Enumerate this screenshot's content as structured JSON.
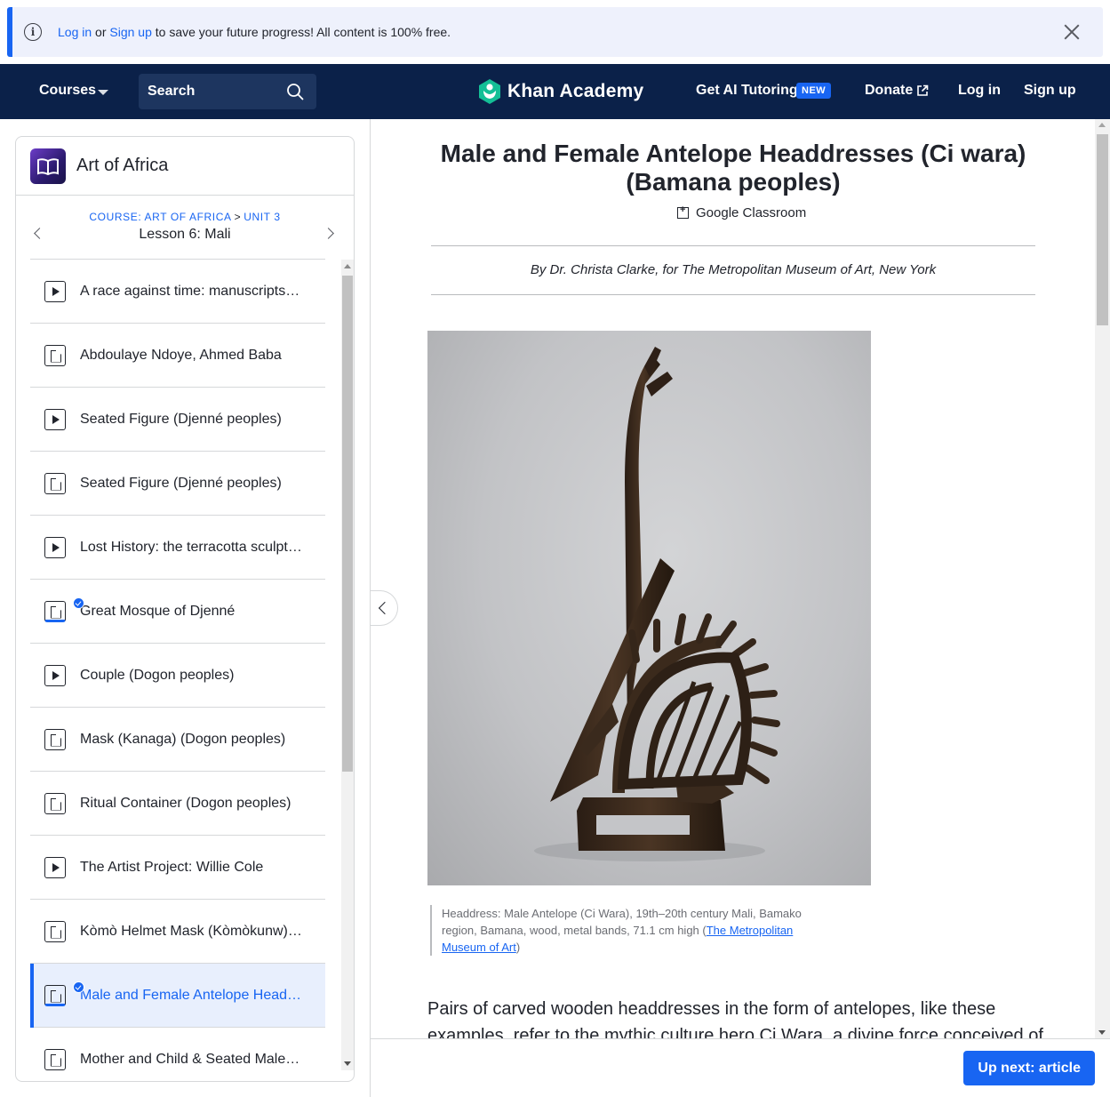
{
  "banner": {
    "login_link": "Log in",
    "or_text": " or ",
    "signup_link": "Sign up",
    "message": " to save your future progress! All content is 100% free."
  },
  "nav": {
    "courses": "Courses",
    "search_placeholder": "Search",
    "logo_text": "Khan Academy",
    "ai_tutoring": "Get AI Tutoring",
    "new_badge": "NEW",
    "donate": "Donate",
    "login": "Log in",
    "signup": "Sign up",
    "brand_color": "#0b2149",
    "accent_color": "#1865f2"
  },
  "sidebar": {
    "course_title": "Art of Africa",
    "breadcrumb_course": "COURSE: ART OF AFRICA",
    "breadcrumb_sep": ">",
    "breadcrumb_unit": "UNIT 3",
    "lesson_title": "Lesson 6: Mali",
    "items": [
      {
        "label": "A race against time: manuscripts of Timbuktu",
        "type": "video",
        "done": false,
        "active": false
      },
      {
        "label": "Abdoulaye Ndoye, Ahmed Baba",
        "type": "article",
        "done": false,
        "active": false
      },
      {
        "label": "Seated Figure (Djenné peoples)",
        "type": "video",
        "done": false,
        "active": false
      },
      {
        "label": "Seated Figure (Djenné peoples)",
        "type": "article",
        "done": false,
        "active": false
      },
      {
        "label": "Lost History: the terracotta sculpture of Djenné",
        "type": "video",
        "done": false,
        "active": false
      },
      {
        "label": "Great Mosque of Djenné",
        "type": "article",
        "done": true,
        "active": false
      },
      {
        "label": "Couple (Dogon peoples)",
        "type": "video",
        "done": false,
        "active": false
      },
      {
        "label": "Mask (Kanaga) (Dogon peoples)",
        "type": "article",
        "done": false,
        "active": false
      },
      {
        "label": "Ritual Container (Dogon peoples)",
        "type": "article",
        "done": false,
        "active": false
      },
      {
        "label": "The Artist Project: Willie Cole",
        "type": "video",
        "done": false,
        "active": false
      },
      {
        "label": "Kòmò Helmet Mask (Kòmòkunw) (Bamana peoples)",
        "type": "article",
        "done": false,
        "active": false
      },
      {
        "label": "Male and Female Antelope Headdresses (Ci wara)",
        "type": "article",
        "done": true,
        "active": true
      },
      {
        "label": "Mother and Child & Seated Male Figure",
        "type": "article",
        "done": false,
        "active": false
      }
    ]
  },
  "article": {
    "title": "Male and Female Antelope Headdresses (Ci wara) (Bamana peoples)",
    "google_classroom": "Google Classroom",
    "byline": "By Dr. Christa Clarke, for The Metropolitan Museum of Art, New York",
    "caption_text": "Headdress: Male Antelope (Ci Wara), 19th–20th century Mali, Bamako region, Bamana, wood, metal bands, 71.1 cm high (",
    "caption_link": "The Metropolitan Museum of Art",
    "caption_end": ")",
    "body": "Pairs of carved wooden headdresses in the form of antelopes, like these examples, refer to the mythic culture hero Ci Wara, a divine force conceived of"
  },
  "footer": {
    "up_next": "Up next: article"
  }
}
